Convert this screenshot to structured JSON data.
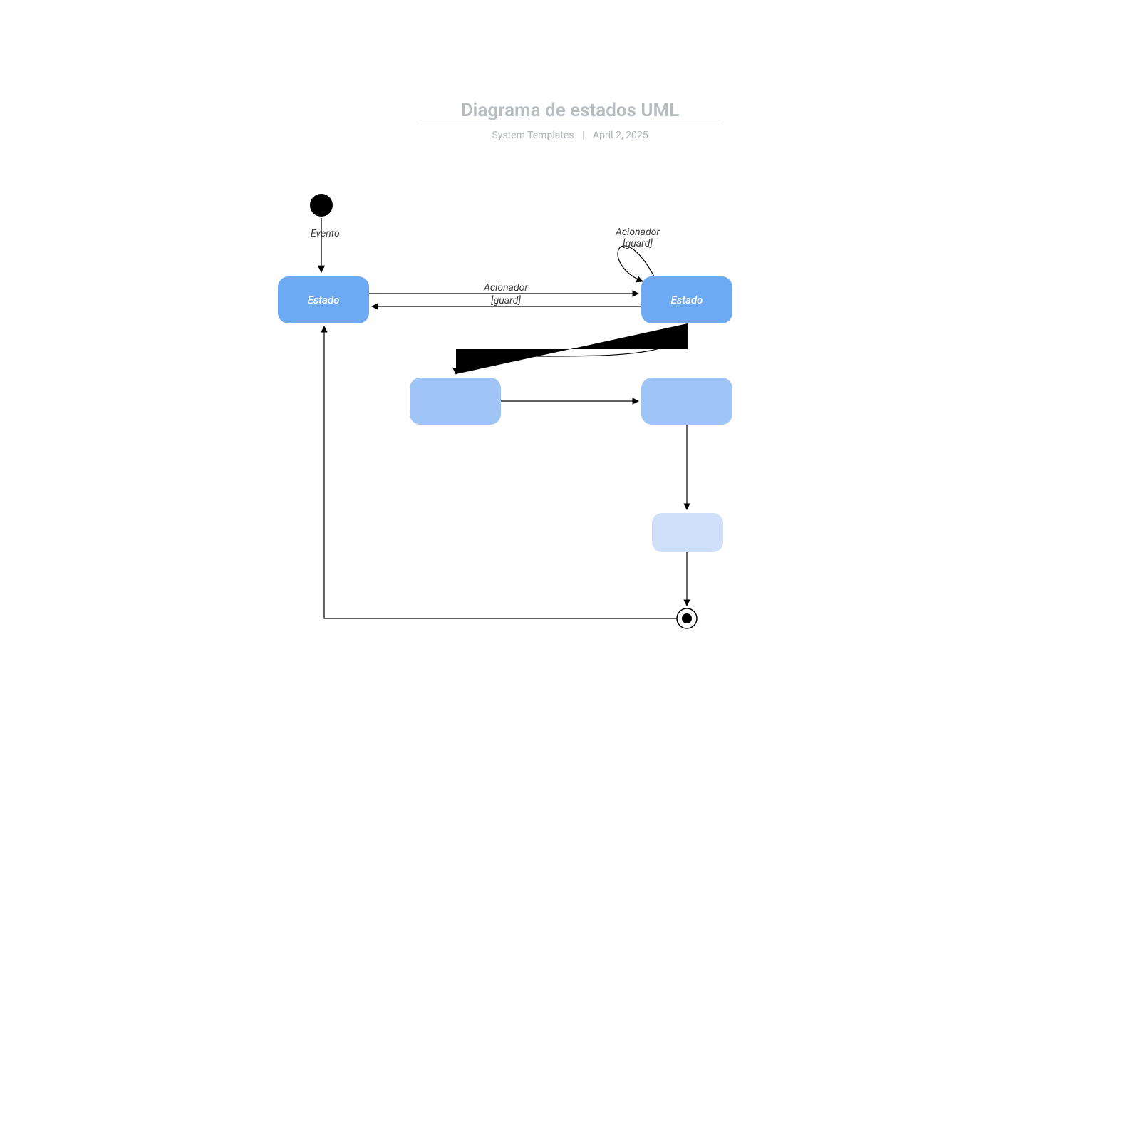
{
  "header": {
    "title": "Diagrama de estados UML",
    "subtitle_left": "System Templates",
    "subtitle_right": "April 2, 2025"
  },
  "labels": {
    "evento": "Evento",
    "acionador": "Acionador",
    "guard": "[guard]",
    "estado": "Estado"
  },
  "colors": {
    "state_primary": "#6aa7f0",
    "state_primary_fill": "#6eaaf3",
    "state_mid": "#9ec5f5",
    "state_light": "#cfe1fa",
    "stroke": "#000000"
  }
}
